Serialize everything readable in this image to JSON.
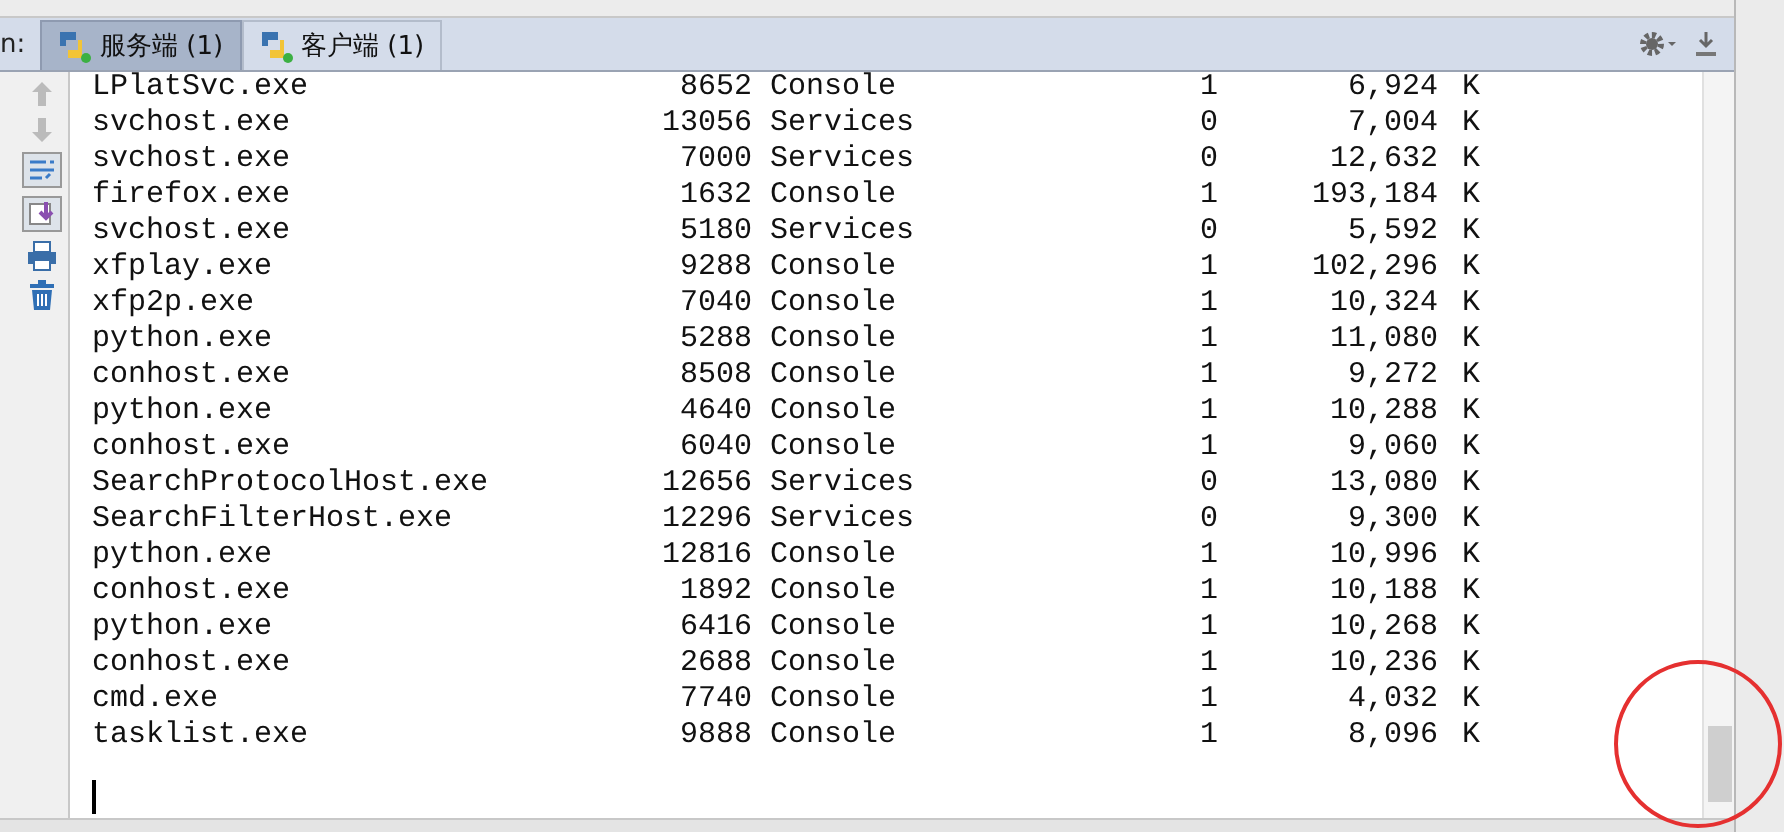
{
  "run_panel": {
    "label": "n:",
    "tabs": [
      {
        "label": "服务端 (1)",
        "selected": true
      },
      {
        "label": "客户端 (1)",
        "selected": false
      }
    ]
  },
  "console": {
    "rows": [
      [
        "LPlatSvc.exe",
        "8652",
        "Console",
        "1",
        "6,924",
        "K"
      ],
      [
        "svchost.exe",
        "13056",
        "Services",
        "0",
        "7,004",
        "K"
      ],
      [
        "svchost.exe",
        "7000",
        "Services",
        "0",
        "12,632",
        "K"
      ],
      [
        "firefox.exe",
        "1632",
        "Console",
        "1",
        "193,184",
        "K"
      ],
      [
        "svchost.exe",
        "5180",
        "Services",
        "0",
        "5,592",
        "K"
      ],
      [
        "xfplay.exe",
        "9288",
        "Console",
        "1",
        "102,296",
        "K"
      ],
      [
        "xfp2p.exe",
        "7040",
        "Console",
        "1",
        "10,324",
        "K"
      ],
      [
        "python.exe",
        "5288",
        "Console",
        "1",
        "11,080",
        "K"
      ],
      [
        "conhost.exe",
        "8508",
        "Console",
        "1",
        "9,272",
        "K"
      ],
      [
        "python.exe",
        "4640",
        "Console",
        "1",
        "10,288",
        "K"
      ],
      [
        "conhost.exe",
        "6040",
        "Console",
        "1",
        "9,060",
        "K"
      ],
      [
        "SearchProtocolHost.exe",
        "12656",
        "Services",
        "0",
        "13,080",
        "K"
      ],
      [
        "SearchFilterHost.exe",
        "12296",
        "Services",
        "0",
        "9,300",
        "K"
      ],
      [
        "python.exe",
        "12816",
        "Console",
        "1",
        "10,996",
        "K"
      ],
      [
        "conhost.exe",
        "1892",
        "Console",
        "1",
        "10,188",
        "K"
      ],
      [
        "python.exe",
        "6416",
        "Console",
        "1",
        "10,268",
        "K"
      ],
      [
        "conhost.exe",
        "2688",
        "Console",
        "1",
        "10,236",
        "K"
      ],
      [
        "cmd.exe",
        "7740",
        "Console",
        "1",
        "4,032",
        "K"
      ],
      [
        "tasklist.exe",
        "9888",
        "Console",
        "1",
        "8,096",
        "K"
      ]
    ]
  }
}
